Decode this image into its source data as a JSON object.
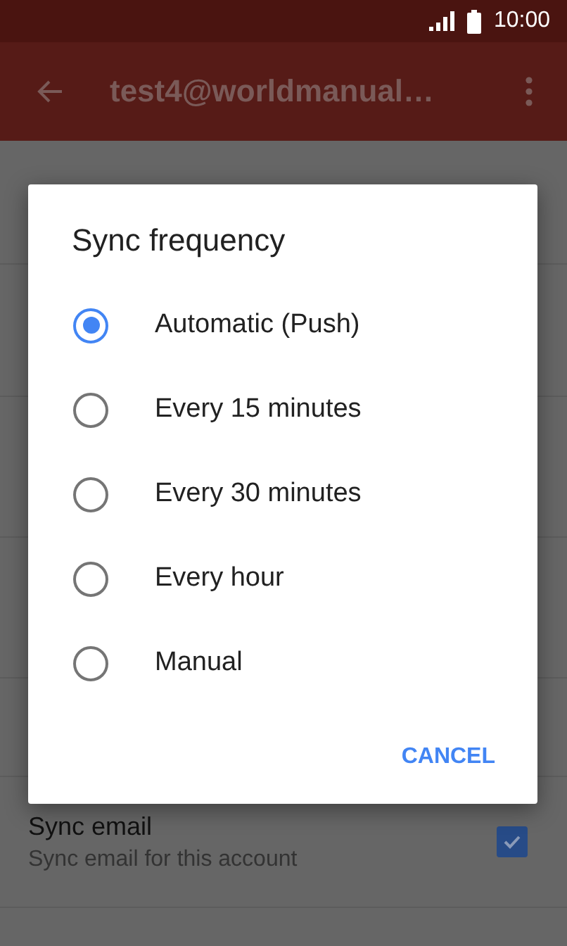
{
  "status_bar": {
    "time": "10:00"
  },
  "app_bar": {
    "title": "test4@worldmanual…"
  },
  "settings": [
    {
      "kind": "blank"
    },
    {
      "kind": "blank"
    },
    {
      "kind": "blank"
    },
    {
      "kind": "blank"
    },
    {
      "kind": "blank"
    },
    {
      "kind": "checkbox",
      "title": "Sync email",
      "summary": "Sync email for this account",
      "checked": true
    }
  ],
  "dialog": {
    "title": "Sync frequency",
    "options": [
      {
        "label": "Automatic (Push)",
        "selected": true
      },
      {
        "label": "Every 15 minutes",
        "selected": false
      },
      {
        "label": "Every 30 minutes",
        "selected": false
      },
      {
        "label": "Every hour",
        "selected": false
      },
      {
        "label": "Manual",
        "selected": false
      }
    ],
    "buttons": [
      "CANCEL"
    ]
  }
}
